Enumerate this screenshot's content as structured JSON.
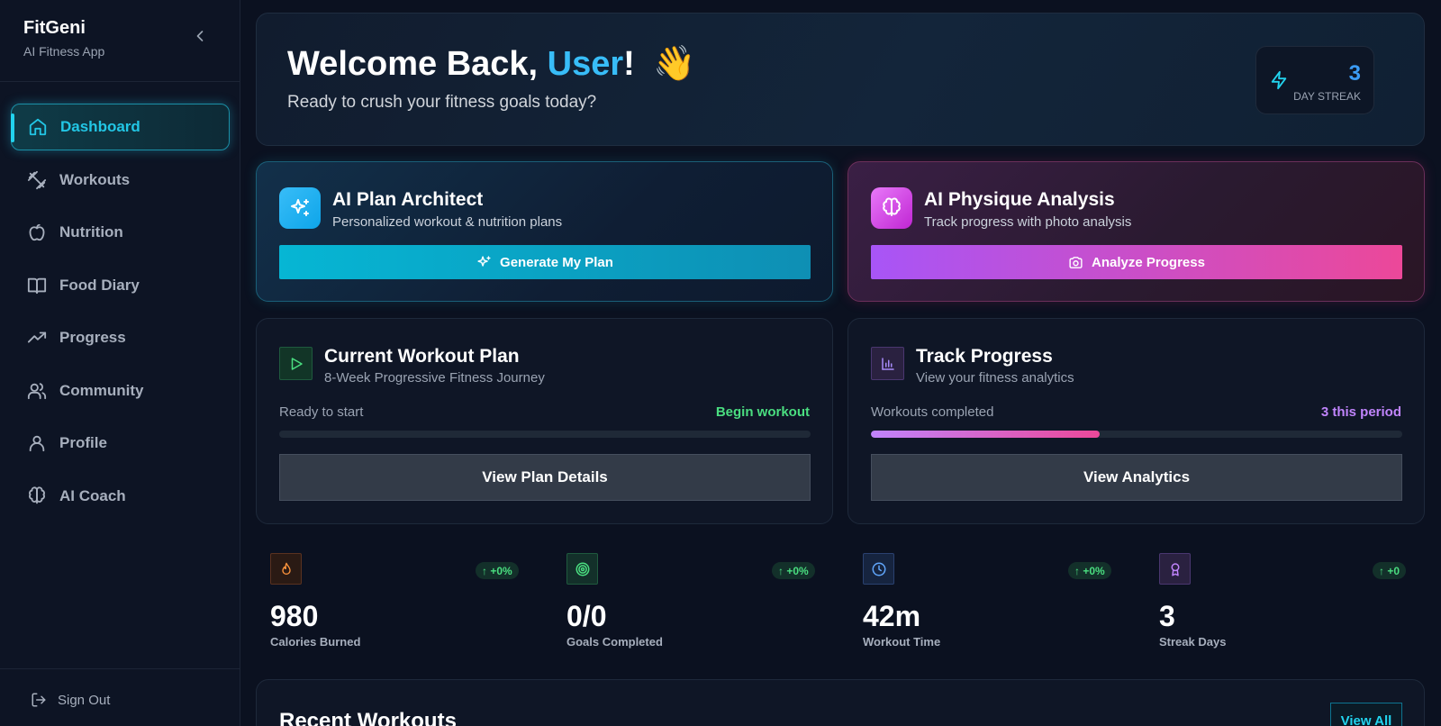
{
  "app": {
    "name": "FitGeni",
    "subtitle": "AI Fitness App"
  },
  "sidebar": {
    "items": [
      {
        "label": "Dashboard",
        "icon": "home-icon",
        "active": true
      },
      {
        "label": "Workouts",
        "icon": "dumbbell-icon"
      },
      {
        "label": "Nutrition",
        "icon": "apple-icon"
      },
      {
        "label": "Food Diary",
        "icon": "book-icon"
      },
      {
        "label": "Progress",
        "icon": "trending-up-icon"
      },
      {
        "label": "Community",
        "icon": "users-icon"
      },
      {
        "label": "Profile",
        "icon": "user-icon"
      },
      {
        "label": "AI Coach",
        "icon": "brain-icon"
      }
    ],
    "sign_out": "Sign Out"
  },
  "hero": {
    "greeting": "Welcome Back, ",
    "user": "User",
    "exclaim": "!",
    "wave": "👋",
    "subtitle": "Ready to crush your fitness goals today?",
    "streak_value": "3",
    "streak_label": "DAY STREAK"
  },
  "ai_cards": [
    {
      "title": "AI Plan Architect",
      "subtitle": "Personalized workout & nutrition plans",
      "button": "Generate My Plan"
    },
    {
      "title": "AI Physique Analysis",
      "subtitle": "Track progress with photo analysis",
      "button": "Analyze Progress"
    }
  ],
  "plan_card": {
    "title": "Current Workout Plan",
    "subtitle": "8-Week Progressive Fitness Journey",
    "row_label": "Ready to start",
    "row_value": "Begin workout",
    "progress": 0,
    "button": "View Plan Details"
  },
  "track_card": {
    "title": "Track Progress",
    "subtitle": "View your fitness analytics",
    "row_label": "Workouts completed",
    "row_value": "3 this period",
    "progress": 0.43,
    "button": "View Analytics"
  },
  "stats": [
    {
      "value": "980",
      "label": "Calories Burned",
      "badge": "↑ +0%",
      "icon": "flame-icon"
    },
    {
      "value": "0/0",
      "label": "Goals Completed",
      "badge": "↑ +0%",
      "icon": "target-icon"
    },
    {
      "value": "42m",
      "label": "Workout Time",
      "badge": "↑ +0%",
      "icon": "clock-icon"
    },
    {
      "value": "3",
      "label": "Streak Days",
      "badge": "↑ +0",
      "icon": "award-icon"
    }
  ],
  "recent": {
    "title": "Recent Workouts",
    "view_all": "View All"
  },
  "colors": {
    "accent": "#22d3ee",
    "brand_blue": "#38bdf8",
    "pink": "#ec4899",
    "purple": "#a855f7",
    "green": "#4ade80"
  }
}
